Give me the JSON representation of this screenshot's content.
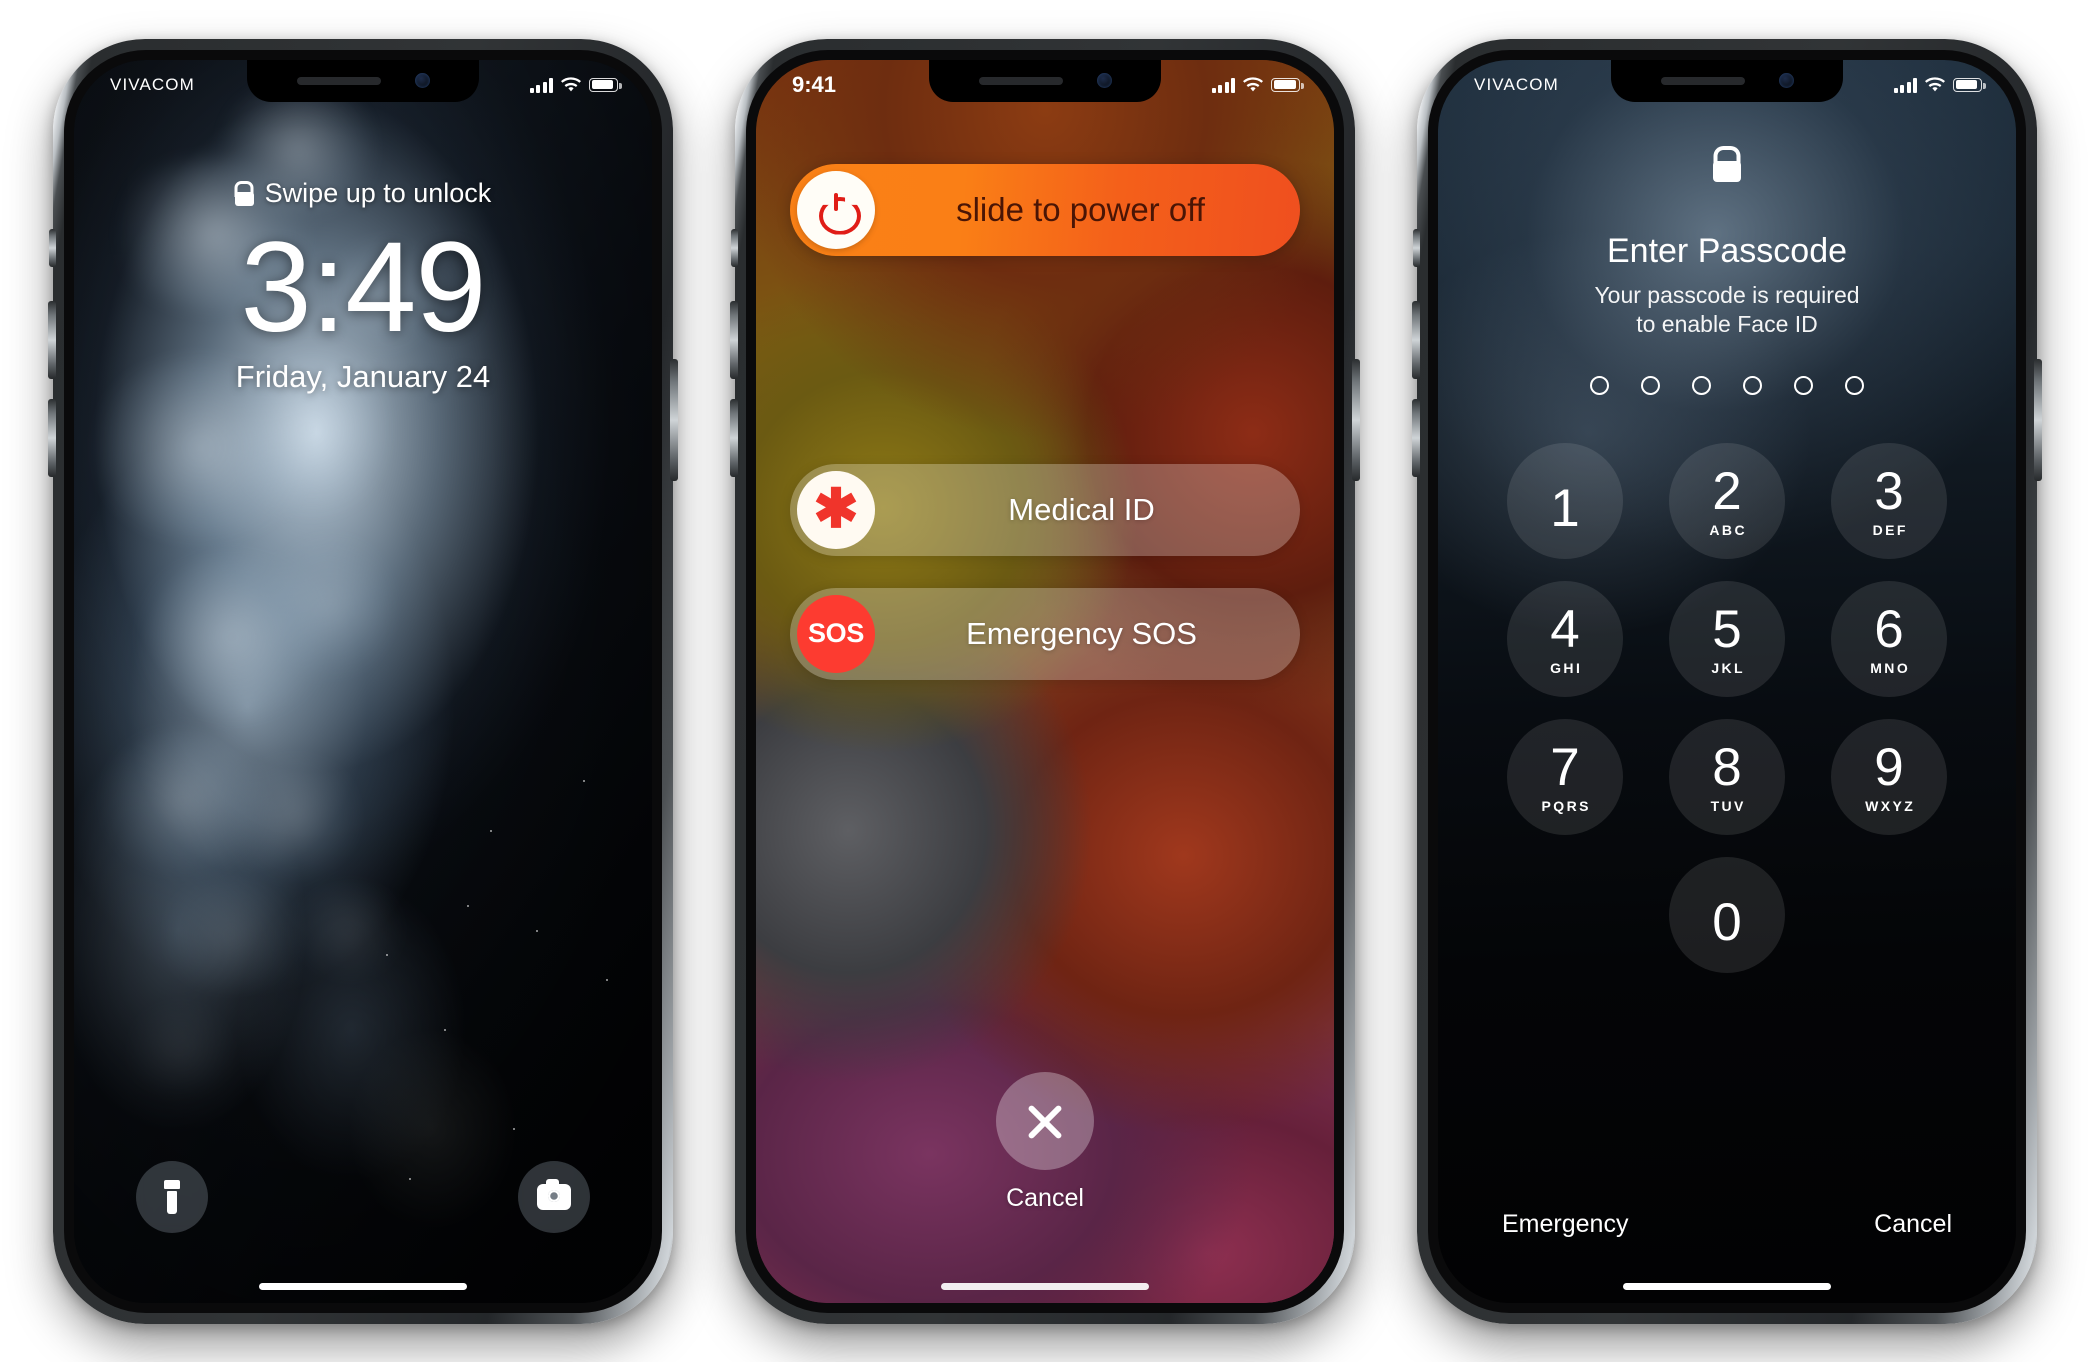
{
  "phones": {
    "lock": {
      "status": {
        "carrier": "VIVACOM",
        "signal_icon": "cellular-bars-icon",
        "wifi_icon": "wifi-icon",
        "battery_icon": "battery-icon"
      },
      "swipe_hint": "Swipe up to unlock",
      "lock_icon": "lock-icon",
      "time": "3:49",
      "date": "Friday, January 24",
      "flashlight_icon": "flashlight-icon",
      "camera_icon": "camera-icon"
    },
    "power_off": {
      "status": {
        "time": "9:41",
        "signal_icon": "cellular-bars-icon",
        "wifi_icon": "wifi-icon",
        "battery_icon": "battery-icon"
      },
      "slider": {
        "label": "slide to power off",
        "icon": "power-icon",
        "accent": "#f87c16"
      },
      "options": [
        {
          "label": "Medical ID",
          "icon": "medical-id-asterisk-icon",
          "glyph": "✱",
          "color": "#f0342b"
        },
        {
          "label": "Emergency SOS",
          "icon": "sos-icon",
          "glyph": "SOS",
          "color": "#fd3b30"
        }
      ],
      "cancel": {
        "label": "Cancel",
        "icon": "close-x-icon"
      }
    },
    "passcode": {
      "status": {
        "carrier": "VIVACOM",
        "signal_icon": "cellular-bars-icon",
        "wifi_icon": "wifi-icon",
        "battery_icon": "battery-icon"
      },
      "lock_icon": "lock-icon",
      "title": "Enter Passcode",
      "subtitle_line1": "Your passcode is required",
      "subtitle_line2": "to enable Face ID",
      "dot_count": 6,
      "filled_dots": 0,
      "keys": [
        {
          "digit": "1",
          "letters": ""
        },
        {
          "digit": "2",
          "letters": "ABC"
        },
        {
          "digit": "3",
          "letters": "DEF"
        },
        {
          "digit": "4",
          "letters": "GHI"
        },
        {
          "digit": "5",
          "letters": "JKL"
        },
        {
          "digit": "6",
          "letters": "MNO"
        },
        {
          "digit": "7",
          "letters": "PQRS"
        },
        {
          "digit": "8",
          "letters": "TUV"
        },
        {
          "digit": "9",
          "letters": "WXYZ"
        },
        {
          "digit": "0",
          "letters": ""
        }
      ],
      "footer": {
        "emergency": "Emergency",
        "cancel": "Cancel"
      }
    }
  }
}
